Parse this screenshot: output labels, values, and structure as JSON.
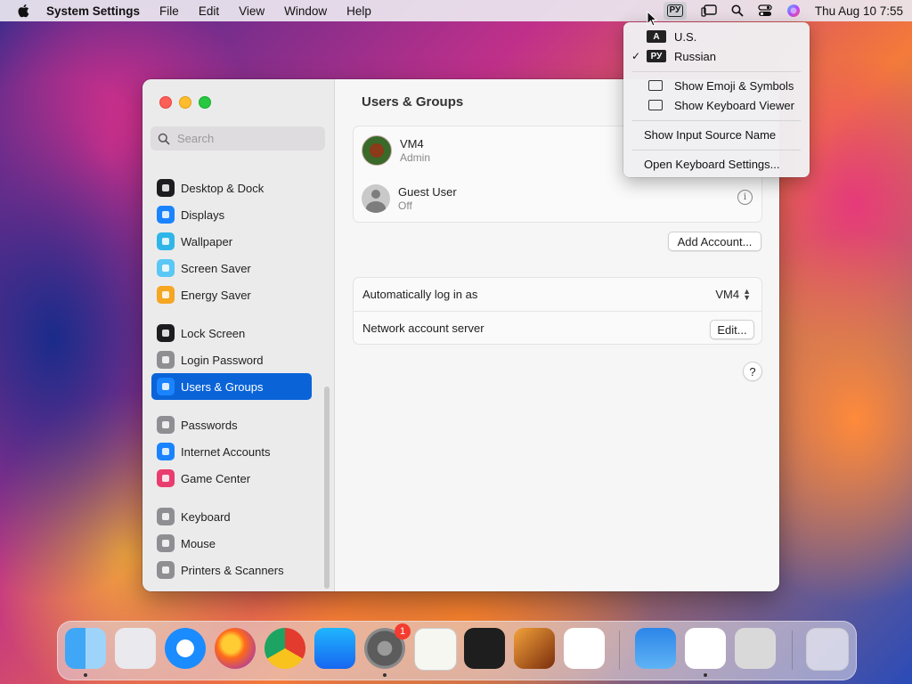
{
  "menubar": {
    "app_name": "System Settings",
    "menus": [
      "File",
      "Edit",
      "View",
      "Window",
      "Help"
    ],
    "input_source": "РУ",
    "clock": "Thu Aug 10  7:55"
  },
  "input_menu": {
    "items": [
      {
        "badge": "A",
        "label": "U.S.",
        "checked": false
      },
      {
        "badge": "РУ",
        "label": "Russian",
        "checked": true
      }
    ],
    "check_mark": "✓",
    "emoji": "Show Emoji & Symbols",
    "keyboard_viewer": "Show Keyboard Viewer",
    "input_source_name": "Show Input Source Name",
    "keyboard_settings": "Open Keyboard Settings..."
  },
  "sidebar": {
    "search_placeholder": "Search",
    "groups": [
      [
        {
          "label": "Desktop & Dock",
          "icon": "dock-icon",
          "color": "#1d1d1f"
        },
        {
          "label": "Displays",
          "icon": "sun-icon",
          "color": "#1a84ff"
        },
        {
          "label": "Wallpaper",
          "icon": "flower-icon",
          "color": "#2fb6e8"
        },
        {
          "label": "Screen Saver",
          "icon": "screen-icon",
          "color": "#5ac8f5"
        },
        {
          "label": "Energy Saver",
          "icon": "bulb-icon",
          "color": "#f5a623"
        }
      ],
      [
        {
          "label": "Lock Screen",
          "icon": "lock-icon",
          "color": "#1d1d1f"
        },
        {
          "label": "Login Password",
          "icon": "padlock-icon",
          "color": "#8e8e93"
        },
        {
          "label": "Users & Groups",
          "icon": "users-icon",
          "color": "#1a84ff",
          "selected": true
        }
      ],
      [
        {
          "label": "Passwords",
          "icon": "key-icon",
          "color": "#8e8e93"
        },
        {
          "label": "Internet Accounts",
          "icon": "at-icon",
          "color": "#1a84ff"
        },
        {
          "label": "Game Center",
          "icon": "gamecenter-icon",
          "color": "#e83d6e"
        }
      ],
      [
        {
          "label": "Keyboard",
          "icon": "keyboard-icon",
          "color": "#8e8e93"
        },
        {
          "label": "Mouse",
          "icon": "mouse-icon",
          "color": "#8e8e93"
        },
        {
          "label": "Printers & Scanners",
          "icon": "printer-icon",
          "color": "#8e8e93"
        }
      ]
    ]
  },
  "main": {
    "title": "Users & Groups",
    "users": [
      {
        "name": "VM4",
        "role": "Admin"
      },
      {
        "name": "Guest User",
        "role": "Off"
      }
    ],
    "add_account": "Add Account...",
    "auto_login_label": "Automatically log in as",
    "auto_login_value": "VM4",
    "network_label": "Network account server",
    "edit_label": "Edit...",
    "help_label": "?",
    "info_label": "i"
  },
  "dock": {
    "apps": [
      "finder-icon",
      "launchpad-icon",
      "safari-icon",
      "firefox-icon",
      "chrome-icon",
      "appstore-icon",
      "settings-icon",
      "textedit-icon",
      "terminal-icon",
      "garageband-icon",
      "vscode-icon",
      "weather-icon",
      "news-icon",
      "calculator-icon",
      "trash-icon"
    ],
    "settings_badge": "1"
  }
}
